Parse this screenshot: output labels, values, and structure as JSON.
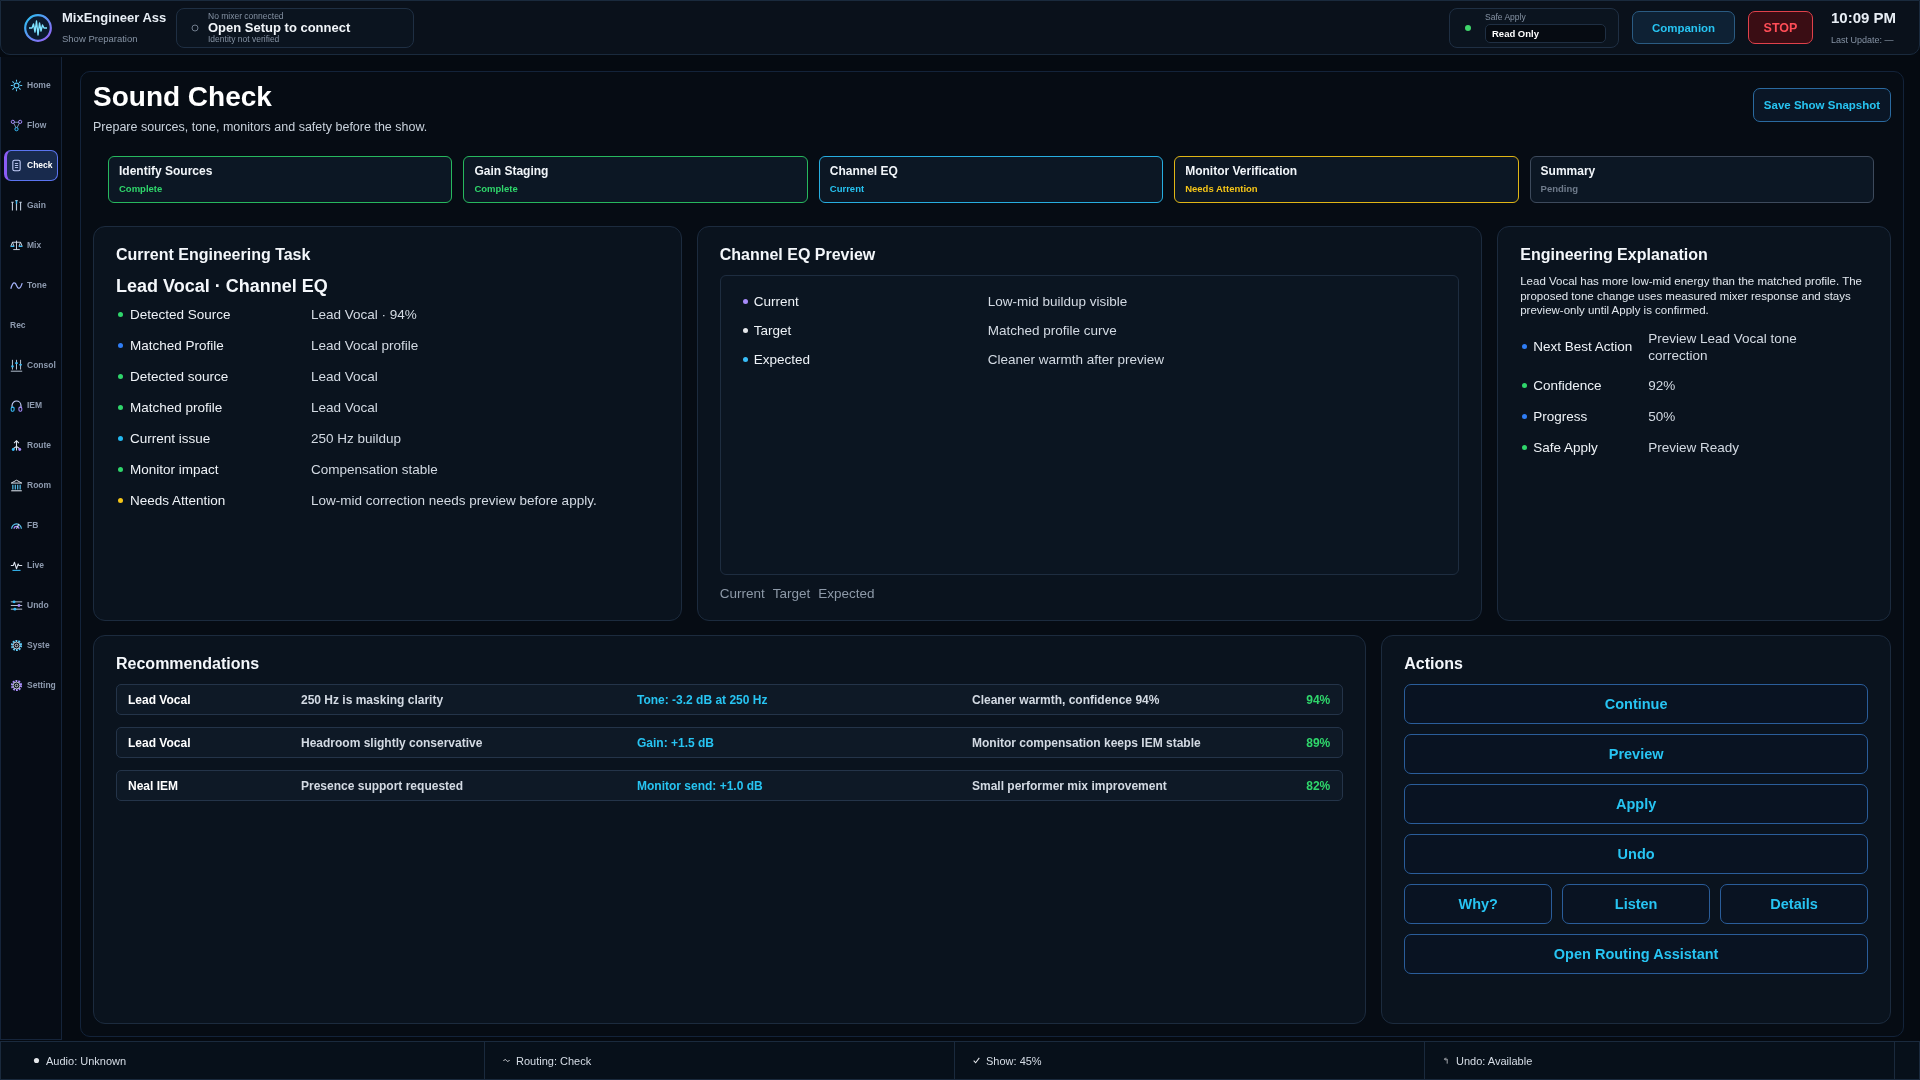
{
  "app": {
    "title": "MixEngineer Ass",
    "subtitle": "Show Preparation"
  },
  "connection": {
    "connected": false,
    "status": "No mixer connected",
    "action": "Open Setup to connect",
    "identity": "Identity not verified"
  },
  "safe_apply": {
    "active": true,
    "label": "Safe Apply",
    "value": "Read Only"
  },
  "header_buttons": [
    {
      "label": "Companion",
      "kind": "companion"
    },
    {
      "label": "STOP",
      "kind": "stop"
    }
  ],
  "clock": {
    "time": "10:09 PM",
    "last_update": "Last Update: —"
  },
  "sidebar": {
    "items": [
      {
        "label": "Home",
        "selected": false
      },
      {
        "label": "Flow",
        "selected": false
      },
      {
        "label": "Check",
        "selected": true
      },
      {
        "label": "Gain",
        "selected": false
      },
      {
        "label": "Mix",
        "selected": false
      },
      {
        "label": "Tone",
        "selected": false
      },
      {
        "label": "Rec",
        "selected": false
      },
      {
        "label": "Consol",
        "selected": false
      },
      {
        "label": "IEM",
        "selected": false
      },
      {
        "label": "Route",
        "selected": false
      },
      {
        "label": "Room",
        "selected": false
      },
      {
        "label": "FB",
        "selected": false
      },
      {
        "label": "Live",
        "selected": false
      },
      {
        "label": "Undo",
        "selected": false
      },
      {
        "label": "Syste",
        "selected": false
      },
      {
        "label": "Setting",
        "selected": false
      }
    ]
  },
  "page": {
    "title": "Sound Check",
    "subtitle": "Prepare sources, tone, monitors and safety before the show.",
    "action": "Save Show Snapshot"
  },
  "steps": [
    {
      "label": "Identify Sources",
      "status": "Complete",
      "kind": "complete"
    },
    {
      "label": "Gain Staging",
      "status": "Complete",
      "kind": "complete"
    },
    {
      "label": "Channel EQ",
      "status": "Current",
      "kind": "current"
    },
    {
      "label": "Monitor Verification",
      "status": "Needs Attention",
      "kind": "attention"
    },
    {
      "label": "Summary",
      "status": "Pending",
      "kind": "pending"
    }
  ],
  "task": {
    "title": "Current Engineering Task",
    "subtitle": "Lead Vocal · Channel EQ",
    "rows": [
      {
        "label": "Detected Source",
        "value": "Lead Vocal · 94%",
        "color": "#2fd66b"
      },
      {
        "label": "Matched Profile",
        "value": "Lead Vocal profile",
        "color": "#2f7df5"
      },
      {
        "label": "Detected source",
        "value": "Lead Vocal",
        "color": "#2fd66b"
      },
      {
        "label": "Matched profile",
        "value": "Lead Vocal",
        "color": "#2fd66b"
      },
      {
        "label": "Current issue",
        "value": "250 Hz buildup",
        "color": "#22b8f0"
      },
      {
        "label": "Monitor impact",
        "value": "Compensation stable",
        "color": "#2fd66b"
      },
      {
        "label": "Needs Attention",
        "value": "Low-mid correction needs preview before apply.",
        "color": "#f5c518"
      }
    ]
  },
  "eq_preview": {
    "title": "Channel EQ Preview",
    "rows": [
      {
        "label": "Current",
        "value": "Low-mid buildup visible",
        "color": "#a78bfa"
      },
      {
        "label": "Target",
        "value": "Matched profile curve",
        "color": "#e5e7eb"
      },
      {
        "label": "Expected",
        "value": "Cleaner warmth after preview",
        "color": "#38bdf8"
      }
    ],
    "legend": [
      "Current",
      "Target",
      "Expected"
    ]
  },
  "explanation": {
    "title": "Engineering Explanation",
    "text": "Lead Vocal has more low-mid energy than the matched profile. The proposed tone change uses measured mixer response and stays preview-only until Apply is confirmed.",
    "rows": [
      {
        "label": "Next Best Action",
        "value": "Preview Lead Vocal tone correction",
        "color": "#2f7df5"
      },
      {
        "label": "Confidence",
        "value": "92%",
        "color": "#2fd66b"
      },
      {
        "label": "Progress",
        "value": "50%",
        "color": "#2f7df5"
      },
      {
        "label": "Safe Apply",
        "value": "Preview Ready",
        "color": "#2fd66b"
      }
    ]
  },
  "recommendations": {
    "title": "Recommendations",
    "rows": [
      {
        "source": "Lead Vocal",
        "issue": "250 Hz is masking clarity",
        "change": "Tone: -3.2 dB at 250 Hz",
        "outcome": "Cleaner warmth, confidence 94%",
        "confidence": "94%"
      },
      {
        "source": "Lead Vocal",
        "issue": "Headroom slightly conservative",
        "change": "Gain: +1.5 dB",
        "outcome": "Monitor compensation keeps IEM stable",
        "confidence": "89%"
      },
      {
        "source": "Neal IEM",
        "issue": "Presence support requested",
        "change": "Monitor send: +1.0 dB",
        "outcome": "Small performer mix improvement",
        "confidence": "82%"
      }
    ]
  },
  "actions": {
    "title": "Actions",
    "rows": [
      [
        "Continue"
      ],
      [
        "Preview"
      ],
      [
        "Apply"
      ],
      [
        "Undo"
      ],
      [
        "Why?",
        "Listen",
        "Details"
      ],
      [
        "Open Routing Assistant"
      ]
    ]
  },
  "status_bar": [
    {
      "text": "Audio: Unknown"
    },
    {
      "text": "Routing: Check"
    },
    {
      "text": "Show: 45%"
    },
    {
      "text": "Undo: Available"
    }
  ]
}
